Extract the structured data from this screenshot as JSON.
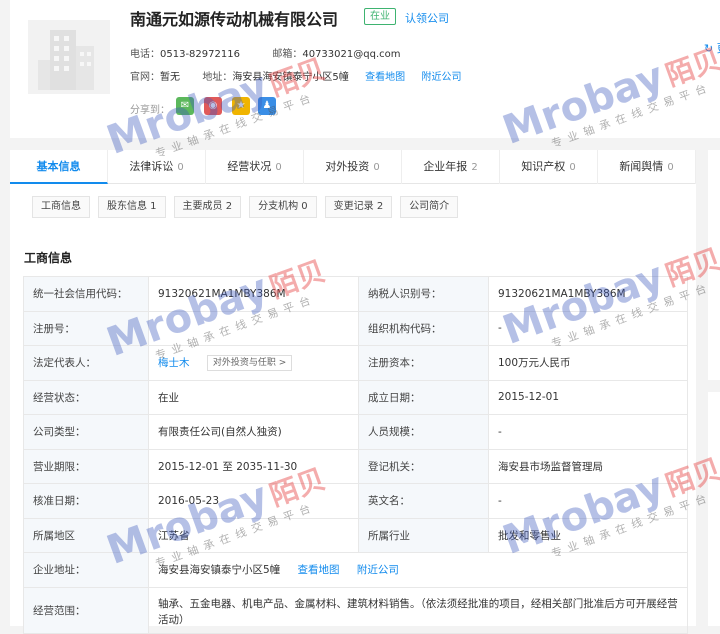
{
  "company": {
    "name": "南通元如源传动机械有限公司",
    "status_badge": "在业",
    "claim_link": "认领公司",
    "phone_label": "电话：",
    "phone": "0513-82972116",
    "email_label": "邮箱：",
    "email": "40733021@qq.com",
    "website_label": "官网：",
    "website": "暂无",
    "address_label": "地址：",
    "address": "海安县海安镇泰宁小区5幢",
    "view_map": "查看地图",
    "nearby": "附近公司",
    "refresh": "更",
    "share_label": "分享到："
  },
  "tabs": [
    {
      "label": "基本信息",
      "count": ""
    },
    {
      "label": "法律诉讼",
      "count": "0"
    },
    {
      "label": "经营状况",
      "count": "0"
    },
    {
      "label": "对外投资",
      "count": "0"
    },
    {
      "label": "企业年报",
      "count": "2"
    },
    {
      "label": "知识产权",
      "count": "0"
    },
    {
      "label": "新闻舆情",
      "count": "0"
    }
  ],
  "subtabs": [
    "工商信息",
    "股东信息 1",
    "主要成员 2",
    "分支机构 0",
    "变更记录 2",
    "公司简介"
  ],
  "section_title": "工商信息",
  "info": {
    "credit_code_label": "统一社会信用代码：",
    "credit_code": "91320621MA1MBY386M",
    "taxpayer_label": "纳税人识别号：",
    "taxpayer": "91320621MA1MBY386M",
    "reg_no_label": "注册号：",
    "reg_no": "",
    "org_code_label": "组织机构代码：",
    "org_code": "-",
    "legal_rep_label": "法定代表人：",
    "legal_rep": "梅士木",
    "legal_rep_btn": "对外投资与任职 >",
    "capital_label": "注册资本：",
    "capital": "100万元人民币",
    "status_label": "经营状态：",
    "status": "在业",
    "founded_label": "成立日期：",
    "founded": "2015-12-01",
    "type_label": "公司类型：",
    "type": "有限责任公司(自然人独资)",
    "staff_label": "人员规模：",
    "staff": "-",
    "term_label": "营业期限：",
    "term": "2015-12-01 至 2035-11-30",
    "authority_label": "登记机关：",
    "authority": "海安县市场监督管理局",
    "approval_label": "核准日期：",
    "approval": "2016-05-23",
    "en_name_label": "英文名：",
    "en_name": "-",
    "region_label": "所属地区",
    "region": "江苏省",
    "industry_label": "所属行业",
    "industry": "批发和零售业",
    "address_label": "企业地址：",
    "address": "海安县海安镇泰宁小区5幢",
    "view_map": "查看地图",
    "nearby": "附近公司",
    "scope_label": "经营范围：",
    "scope": "轴承、五金电器、机电产品、金属材料、建筑材料销售。（依法须经批准的项目，经相关部门批准后方可开展经营活动）"
  },
  "watermark": {
    "en": "Mrobay",
    "cn": "陌贝",
    "sub": "专业轴承在线交易平台"
  },
  "colors": {
    "accent": "#128bed",
    "status_green": "#3eb370",
    "watermark_blue": "#3c5abe",
    "watermark_red": "#e64646"
  }
}
